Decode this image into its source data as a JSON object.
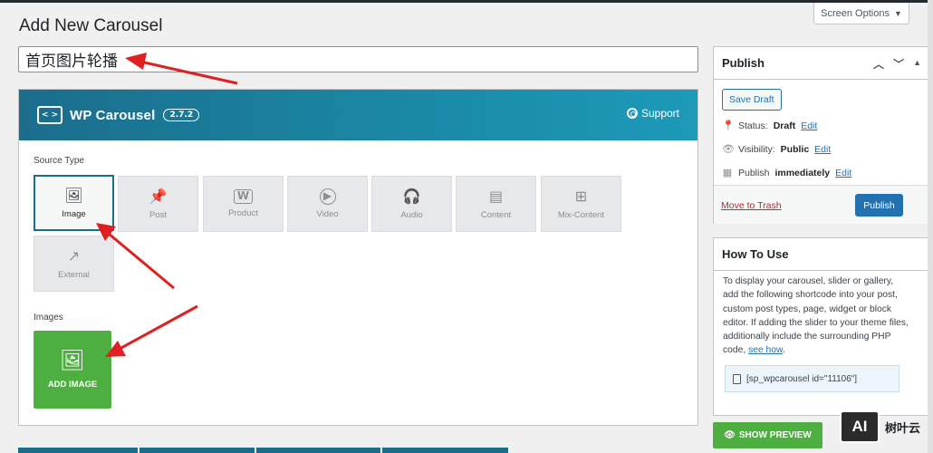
{
  "screen_options": {
    "label": "Screen Options",
    "caret": "▼"
  },
  "page": {
    "title": "Add New Carousel"
  },
  "title_input": {
    "value": "首页图片轮播"
  },
  "plugin": {
    "logo_glyph": "< >",
    "name": "WP Carousel",
    "version": "2.7.2",
    "support_label": "Support"
  },
  "source_type": {
    "label": "Source Type",
    "options": [
      {
        "label": "Image",
        "icon": "image-icon",
        "glyph": "🖼",
        "active": true
      },
      {
        "label": "Post",
        "icon": "pin-icon",
        "glyph": "📌",
        "active": false
      },
      {
        "label": "Product",
        "icon": "woo-icon",
        "glyph": "W",
        "active": false
      },
      {
        "label": "Video",
        "icon": "play-icon",
        "glyph": "▶",
        "active": false
      },
      {
        "label": "Audio",
        "icon": "headphones-icon",
        "glyph": "🎧",
        "active": false
      },
      {
        "label": "Content",
        "icon": "document-icon",
        "glyph": "▤",
        "active": false
      },
      {
        "label": "Mix-Content",
        "icon": "mix-icon",
        "glyph": "⊞",
        "active": false
      },
      {
        "label": "External",
        "icon": "external-link-icon",
        "glyph": "↗",
        "active": false
      }
    ]
  },
  "images": {
    "label": "Images",
    "add_label": "ADD IMAGE",
    "add_glyph": "🖼"
  },
  "publish": {
    "title": "Publish",
    "save_draft": "Save Draft",
    "status_label": "Status:",
    "status_value": "Draft",
    "visibility_label": "Visibility:",
    "visibility_value": "Public",
    "schedule_label": "Publish",
    "schedule_value": "immediately",
    "edit": "Edit",
    "trash": "Move to Trash",
    "publish_button": "Publish"
  },
  "how_to": {
    "title": "How To Use",
    "text": "To display your carousel, slider or gallery, add the following shortcode into your post, custom post types, page, widget or block editor. If adding the slider to your theme files, additionally include the surrounding PHP code, ",
    "link": "see how",
    "shortcode": "[sp_wpcarousel id=\"11106\"]"
  },
  "show_preview": {
    "label": "SHOW PREVIEW"
  },
  "watermark": {
    "logo": "AI",
    "text": "树叶云"
  },
  "colors": {
    "accent": "#1b6d8c",
    "green": "#4caf3f",
    "link": "#2271b1",
    "arrow": "#e02020"
  }
}
